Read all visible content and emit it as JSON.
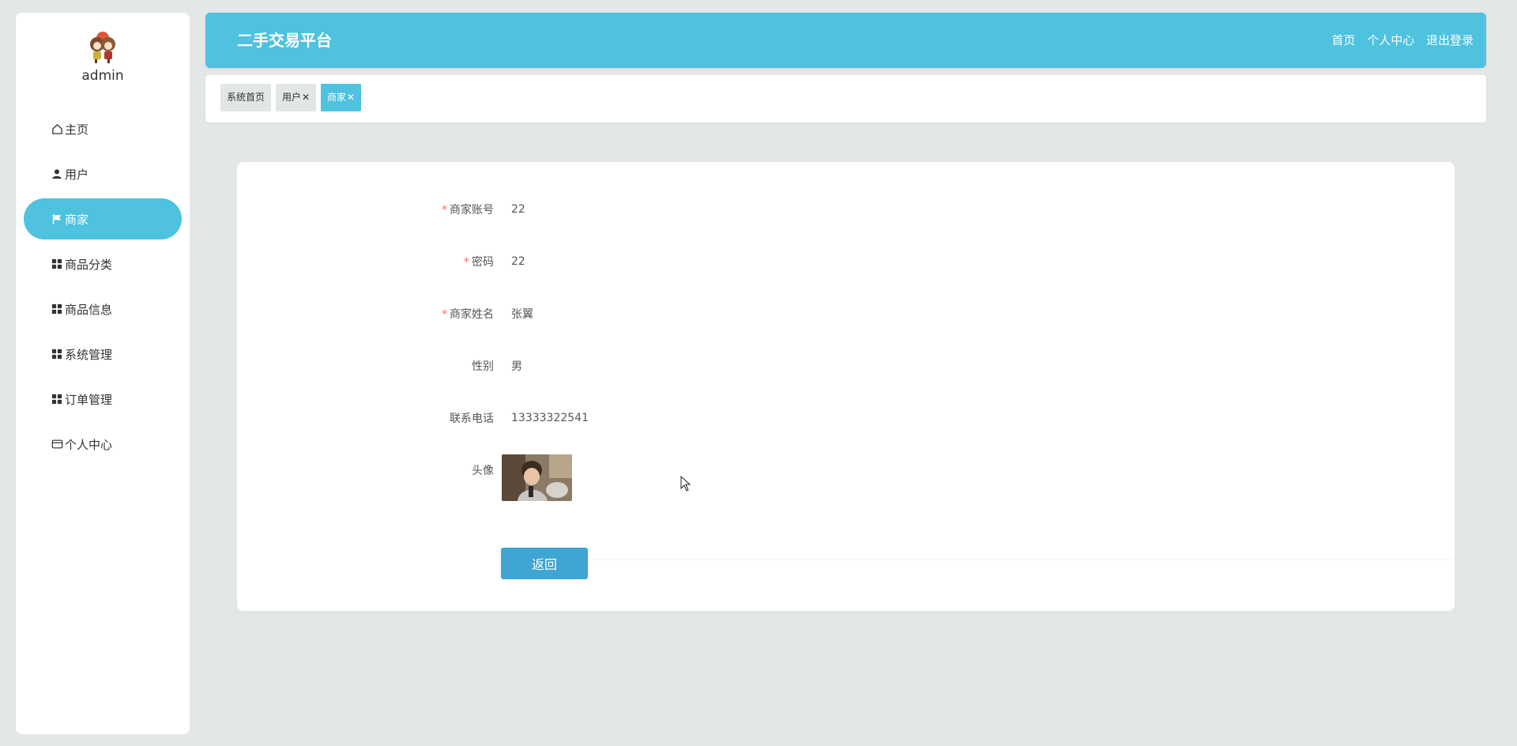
{
  "sidebar": {
    "username": "admin",
    "items": [
      {
        "label": "主页",
        "icon": "home-icon"
      },
      {
        "label": "用户",
        "icon": "user-icon"
      },
      {
        "label": "商家",
        "icon": "flag-icon"
      },
      {
        "label": "商品分类",
        "icon": "grid-icon"
      },
      {
        "label": "商品信息",
        "icon": "grid-icon"
      },
      {
        "label": "系统管理",
        "icon": "grid-icon"
      },
      {
        "label": "订单管理",
        "icon": "grid-icon"
      },
      {
        "label": "个人中心",
        "icon": "card-icon"
      }
    ],
    "active_index": 2
  },
  "header": {
    "title": "二手交易平台",
    "links": [
      "首页",
      "个人中心",
      "退出登录"
    ]
  },
  "tabs": [
    {
      "label": "系统首页",
      "closable": false
    },
    {
      "label": "用户",
      "closable": true
    },
    {
      "label": "商家",
      "closable": true
    }
  ],
  "close_glyph": "✕",
  "form": {
    "fields": [
      {
        "label": "商家账号",
        "value": "22",
        "required": true
      },
      {
        "label": "密码",
        "value": "22",
        "required": true
      },
      {
        "label": "商家姓名",
        "value": "张翼",
        "required": true
      },
      {
        "label": "性别",
        "value": "男",
        "required": false
      },
      {
        "label": "联系电话",
        "value": "13333322541",
        "required": false
      },
      {
        "label": "头像",
        "value": "",
        "required": false
      }
    ],
    "required_mark": "*",
    "back_label": "返回"
  },
  "colors": {
    "accent": "#4ec2df",
    "button": "#3fa5d2",
    "required": "#f56c6c",
    "background": "#e4e7e7"
  }
}
